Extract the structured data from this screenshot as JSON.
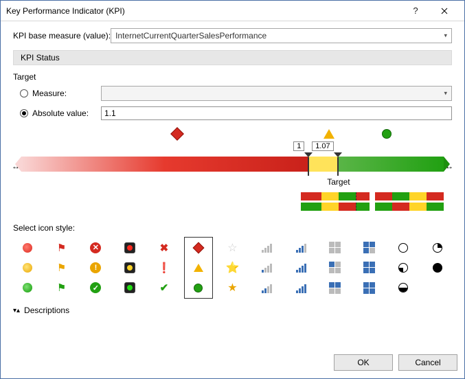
{
  "window": {
    "title": "Key Performance Indicator (KPI)"
  },
  "base": {
    "label": "KPI base measure (value):",
    "value": "InternetCurrentQuarterSalesPerformance"
  },
  "status": {
    "header": "KPI Status",
    "target_label": "Target",
    "measure_label": "Measure:",
    "measure_value": "",
    "abs_label": "Absolute value:",
    "abs_value": "1.1",
    "checked": "absolute"
  },
  "slider": {
    "thumb1": "1",
    "thumb2": "1.07",
    "target_caption": "Target",
    "accent": {
      "red": "#d42a20",
      "yellow": "#f2b200",
      "green": "#22a012"
    }
  },
  "icons": {
    "label": "Select icon style:",
    "selected_index": 5
  },
  "descr": {
    "label": "Descriptions"
  },
  "footer": {
    "ok": "OK",
    "cancel": "Cancel"
  }
}
